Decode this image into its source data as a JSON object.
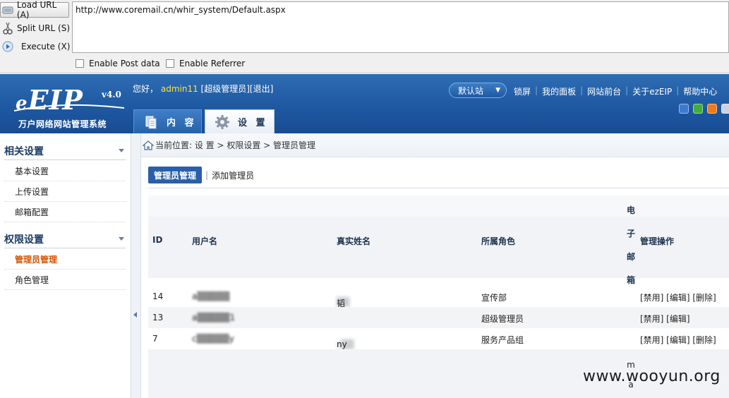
{
  "hackbar": {
    "load_url": "Load URL (A)",
    "split_url": "Split URL (S)",
    "execute": "Execute (X)",
    "url_value": "http://www.coremail.cn/whir_system/Default.aspx",
    "enable_post": "Enable Post data",
    "enable_referrer": "Enable Referrer"
  },
  "header": {
    "logo_text": "EIP",
    "logo_prefix": "e",
    "version": "v4.0",
    "logo_subtitle": "万户网络网站管理系统",
    "greeting": "您好，",
    "username": "admin11",
    "role_link": "[超级管理员]",
    "logout_link": "[退出]",
    "site_select": "默认站",
    "nav": [
      "锁屏",
      "我的面板",
      "网站前台",
      "关于ezEIP",
      "帮助中心"
    ],
    "theme_colors": [
      "#3c7ad0",
      "#3fae3f",
      "#f07a1a",
      "#c8d4e2"
    ],
    "tab_content": "内 容",
    "tab_settings": "设 置"
  },
  "sidebar": {
    "groups": [
      {
        "title": "相关设置",
        "items": [
          "基本设置",
          "上传设置",
          "邮箱配置"
        ]
      },
      {
        "title": "权限设置",
        "items": [
          "管理员管理",
          "角色管理"
        ]
      }
    ],
    "active_item": "管理员管理"
  },
  "main": {
    "breadcrumb": "当前位置: 设 置 > 权限设置 > 管理员管理",
    "subtab_manage": "管理员管理",
    "subtab_sep": "|",
    "subtab_add": "添加管理员",
    "columns": {
      "id": "ID",
      "username": "用户名",
      "realname": "真实姓名",
      "role": "所属角色",
      "email": [
        "电",
        "子",
        "邮",
        "箱"
      ],
      "actions": "管理操作"
    },
    "rows": [
      {
        "id": "14",
        "username": "a▒▒▒▒▒",
        "realname_blur": "▒▒",
        "realname_tail": "韬",
        "role": "宣传部",
        "actions": "[禁用] [编辑] [删除]"
      },
      {
        "id": "13",
        "username": "a▒▒▒▒▒1",
        "realname_blur": "",
        "realname_tail": "",
        "role": "超级管理员",
        "actions": "[禁用] [编辑]"
      },
      {
        "id": "7",
        "username": "c▒▒▒▒▒y",
        "realname_blur": "s▒▒",
        "realname_tail": "ny",
        "role": "服务产品组",
        "actions": "[禁用] [编辑] [删除]"
      }
    ],
    "footer_text": [
      "m",
      "a"
    ]
  },
  "watermark": "www.wooyun.org"
}
